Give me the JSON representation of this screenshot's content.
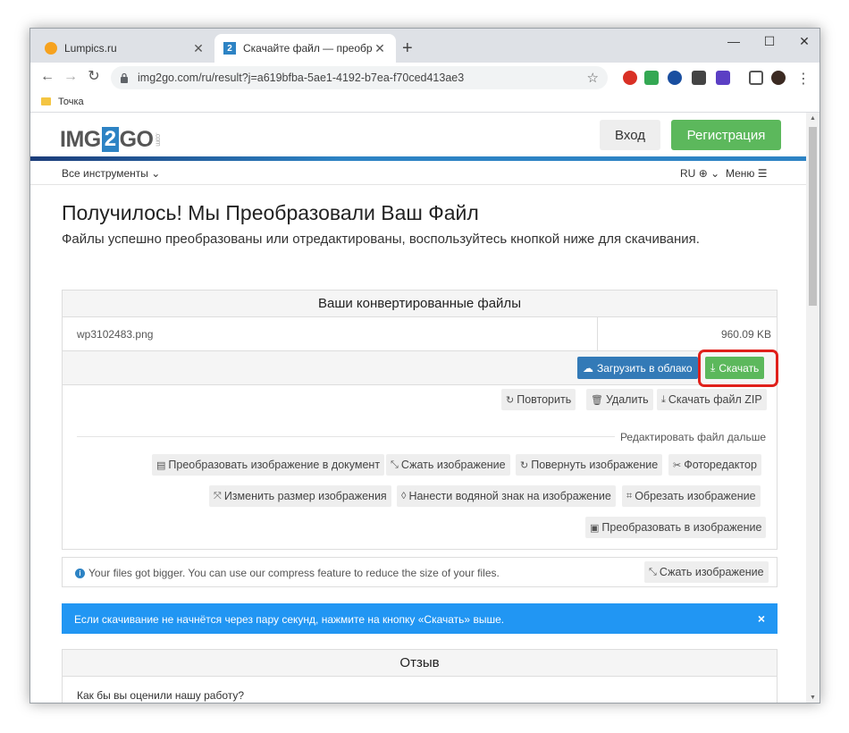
{
  "browser": {
    "tabs": [
      {
        "title": "Lumpics.ru",
        "active": false
      },
      {
        "title": "Скачайте файл — преобразова",
        "active": true
      }
    ],
    "tab_close": "✕",
    "new_tab": "+",
    "controls": {
      "minimize": "—",
      "maximize": "☐",
      "close": "✕"
    },
    "url": "img2go.com/ru/result?j=a619bfba-5ae1-4192-b7ea-f70ced413ae3",
    "bookmarks": [
      {
        "label": "Точка"
      }
    ]
  },
  "site": {
    "logo": {
      "part1": "IMG",
      "part2": "2",
      "part3": "GO",
      "suffix": ".com"
    },
    "login_label": "Вход",
    "register_label": "Регистрация",
    "nav": {
      "tools": "Все инструменты",
      "lang": "RU",
      "menu": "Меню"
    }
  },
  "result": {
    "title": "Получилось! Мы Преобразовали Ваш Файл",
    "lead": "Файлы успешно преобразованы или отредактированы, воспользуйтесь кнопкой ниже для скачивания.",
    "panel_title": "Ваши конвертированные файлы",
    "file": {
      "name": "wp3102483.png",
      "size": "960.09 KB"
    },
    "cloud_label": "Загрузить в облако",
    "download_label": "Скачать",
    "actions": {
      "repeat": "Повторить",
      "delete": "Удалить",
      "zip": "Скачать файл ZIP"
    },
    "edit_label": "Редактировать файл дальше",
    "tools": {
      "to_doc": "Преобразовать изображение в документ",
      "compress": "Сжать изображение",
      "rotate": "Повернуть изображение",
      "photo_editor": "Фоторедактор",
      "resize": "Изменить размер изображения",
      "watermark": "Нанести водяной знак на изображение",
      "crop": "Обрезать изображение",
      "to_image": "Преобразовать в изображение"
    }
  },
  "notice": {
    "text": "Your files got bigger. You can use our compress feature to reduce the size of your files.",
    "button": "Сжать изображение"
  },
  "alert": {
    "text": "Если скачивание не начнётся через пару секунд, нажмите на кнопку «Скачать» выше.",
    "close": "×"
  },
  "review": {
    "title": "Отзыв",
    "question": "Как бы вы оценили нашу работу?"
  },
  "colors": {
    "brand_blue": "#2d83c4",
    "success_green": "#5cb85c",
    "alert_blue": "#2196f3",
    "highlight_red": "#e0201b"
  }
}
